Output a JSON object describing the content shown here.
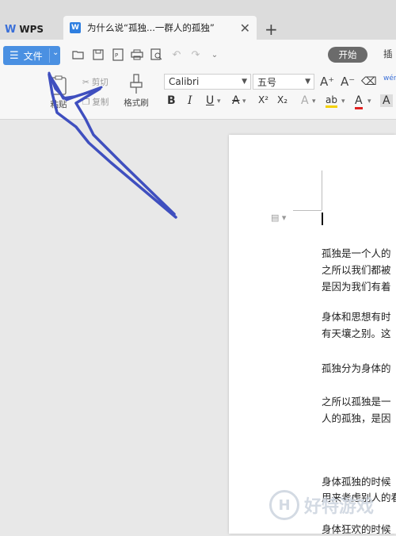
{
  "tabs": {
    "app_label": "WPS",
    "doc_title": "为什么说“孤独...一群人的孤独”",
    "new_tab": "+",
    "close": "✕"
  },
  "toolbar": {
    "file_label": "文件",
    "start_label": "开始",
    "insert_label": "插",
    "paste_label": "粘贴",
    "cut_label": "剪切",
    "copy_label": "复制",
    "format_painter_label": "格式刷",
    "font_name": "Calibri",
    "font_size": "五号",
    "bold": "B",
    "italic": "I",
    "underline": "U",
    "strike": "A",
    "superscript": "X²",
    "subscript": "X₂",
    "grow_font": "A⁺",
    "shrink_font": "A⁻",
    "phonetic": "wén"
  },
  "document": {
    "paragraphs": [
      "孤独是一个人的",
      "之所以我们都被",
      "是因为我们有着",
      "身体和思想有时",
      "有天壤之别。这",
      "孤独分为身体的",
      "之所以孤独是一",
      "人的孤独，是因",
      "身体孤独的时候",
      "用来考虑别人的看",
      "身体狂欢的时候"
    ]
  },
  "watermark": {
    "letter": "H",
    "text": "好特游戏"
  },
  "colors": {
    "accent": "#4a90e2",
    "arrow": "#3f4fbf"
  }
}
